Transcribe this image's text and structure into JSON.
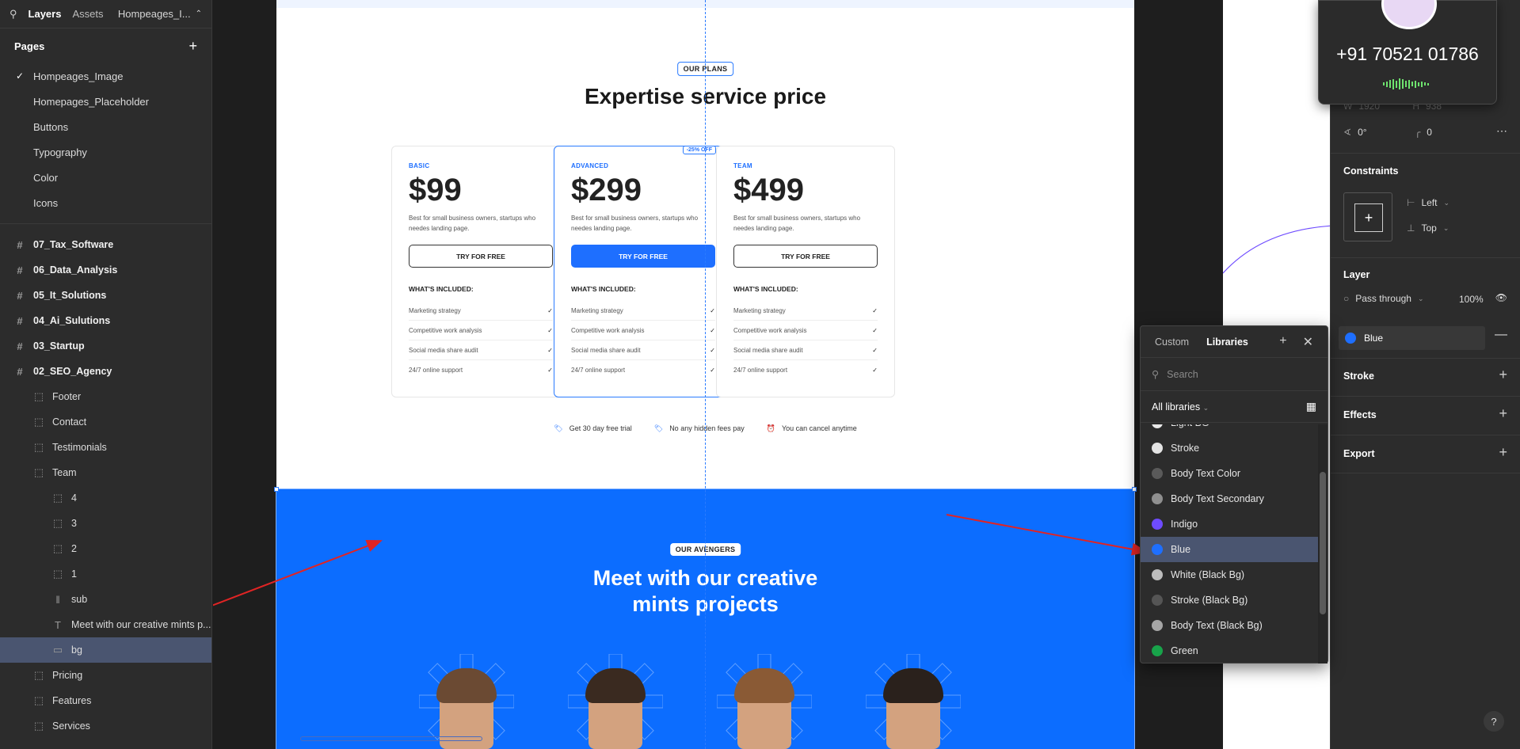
{
  "left_panel": {
    "tabs": [
      "Layers",
      "Assets"
    ],
    "file_name": "Hompeages_I...",
    "pages_title": "Pages",
    "pages": [
      "Hompeages_Image",
      "Homepages_Placeholder",
      "Buttons",
      "Typography",
      "Color",
      "Icons"
    ],
    "layers": [
      {
        "label": "07_Tax_Software",
        "level": 0,
        "type": "frame"
      },
      {
        "label": "06_Data_Analysis",
        "level": 0,
        "type": "frame"
      },
      {
        "label": "05_It_Solutions",
        "level": 0,
        "type": "frame"
      },
      {
        "label": "04_Ai_Sulutions",
        "level": 0,
        "type": "frame"
      },
      {
        "label": "03_Startup",
        "level": 0,
        "type": "frame"
      },
      {
        "label": "02_SEO_Agency",
        "level": 0,
        "type": "frame"
      },
      {
        "label": "Footer",
        "level": 1,
        "type": "section"
      },
      {
        "label": "Contact",
        "level": 1,
        "type": "section"
      },
      {
        "label": "Testimonials",
        "level": 1,
        "type": "section"
      },
      {
        "label": "Team",
        "level": 1,
        "type": "section"
      },
      {
        "label": "4",
        "level": 2,
        "type": "section"
      },
      {
        "label": "3",
        "level": 2,
        "type": "section"
      },
      {
        "label": "2",
        "level": 2,
        "type": "section"
      },
      {
        "label": "1",
        "level": 2,
        "type": "section"
      },
      {
        "label": "sub",
        "level": 2,
        "type": "stack"
      },
      {
        "label": "Meet with our creative mints p...",
        "level": 2,
        "type": "text"
      },
      {
        "label": "bg",
        "level": 2,
        "type": "rect",
        "selected": true
      },
      {
        "label": "Pricing",
        "level": 1,
        "type": "section"
      },
      {
        "label": "Features",
        "level": 1,
        "type": "section"
      },
      {
        "label": "Services",
        "level": 1,
        "type": "section"
      }
    ]
  },
  "canvas": {
    "plans_badge": "OUR PLANS",
    "plans_title": "Expertise service price",
    "plans": [
      {
        "tier": "BASIC",
        "price": "$99",
        "desc": "Best for small business owners, startups who needes landing page.",
        "button": "TRY FOR FREE",
        "primary": false
      },
      {
        "tier": "ADVANCED",
        "price": "$299",
        "desc": "Best for small business owners, startups who needes landing page.",
        "button": "TRY FOR FREE",
        "primary": true,
        "offer": "-25% OFF"
      },
      {
        "tier": "TEAM",
        "price": "$499",
        "desc": "Best for small business owners, startups who needes landing page.",
        "button": "TRY FOR FREE",
        "primary": false
      }
    ],
    "included_title": "WHAT'S INCLUDED:",
    "features": [
      "Marketing strategy",
      "Competitive work analysis",
      "Social media share audit",
      "24/7 online support"
    ],
    "perks": [
      "Get 30 day free trial",
      "No any hidden fees pay",
      "You can cancel anytime"
    ],
    "team_badge": "OUR AVENGERS",
    "team_title_line1": "Meet with our creative",
    "team_title_line2": "mints projects"
  },
  "call_overlay": {
    "number": "+91 70521 01786"
  },
  "right_panel": {
    "w_label": "W",
    "w_value": "1920",
    "h_label": "H",
    "h_value": "938",
    "rotation": "0°",
    "radius": "0",
    "constraints_title": "Constraints",
    "constraint_h": "Left",
    "constraint_v": "Top",
    "layer_title": "Layer",
    "blend": "Pass through",
    "opacity": "100%",
    "fill_name": "Blue",
    "stroke_title": "Stroke",
    "effects_title": "Effects",
    "export_title": "Export"
  },
  "libraries_popup": {
    "tab_custom": "Custom",
    "tab_libraries": "Libraries",
    "search_placeholder": "Search",
    "filter": "All libraries",
    "colors": [
      {
        "name": "Light BG",
        "color": "#e9e9e9"
      },
      {
        "name": "Stroke",
        "color": "#e4e4e4"
      },
      {
        "name": "Body Text Color",
        "color": "#5a5a5a"
      },
      {
        "name": "Body Text Secondary",
        "color": "#8f8f8f"
      },
      {
        "name": "Indigo",
        "color": "#6e4bff"
      },
      {
        "name": "Blue",
        "color": "#1e6fff",
        "selected": true
      },
      {
        "name": "White (Black Bg)",
        "color": "#bdbdbd"
      },
      {
        "name": "Stroke (Black Bg)",
        "color": "#555555"
      },
      {
        "name": "Body Text (Black Bg)",
        "color": "#a6a6a6"
      },
      {
        "name": "Green",
        "color": "#18a34a"
      }
    ]
  },
  "help_label": "?"
}
